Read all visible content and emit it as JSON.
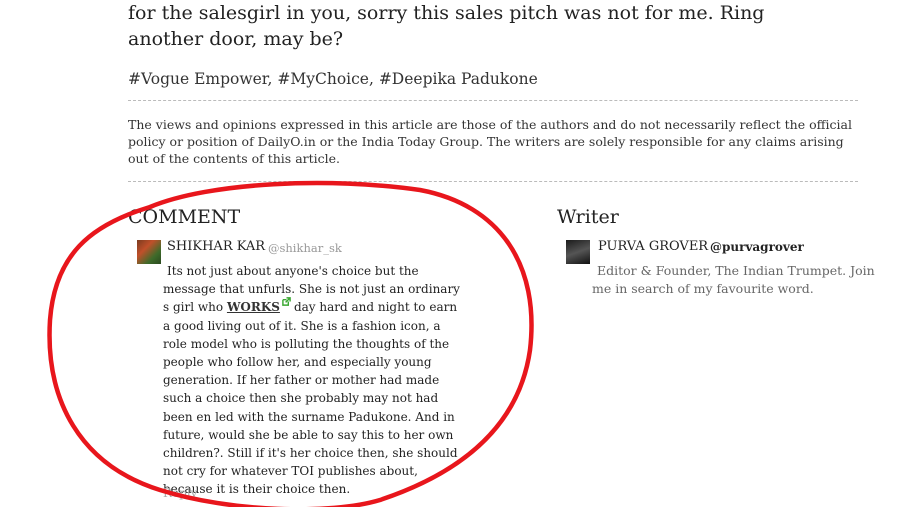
{
  "article": {
    "closing_text": "for the salesgirl in you, sorry this sales pitch was not for me. Ring another door, may be?",
    "tags": "#Vogue Empower, #MyChoice, #Deepika Padukone",
    "disclaimer": "The views and opinions expressed in this article are those of the authors and do not necessarily reflect the official policy or position of DailyO.in or the India Today Group. The writers are solely responsible for any claims arising out of the contents of this article."
  },
  "comments": {
    "heading": "COMMENT",
    "items": [
      {
        "author_name": "SHIKHAR KAR",
        "author_handle": "@shikhar_sk",
        "text_before_link": "Its not just about anyone's choice but the message that unfurls. She is not just an ordinary s girl who",
        "link_text": "WORKS",
        "text_after_link": "day hard and night to earn a good living out of it. She is a fashion icon, a role model who is polluting the thoughts of the people who follow her, and especially young generation. If her father or mother had made such a choice then she probably may not had been en led with the surname Padukone. And in future, would she be able to say this to her own children?. Still if it's her choice then, she should not cry for whatever TOI publishes about, because it is their choice then.",
        "reply_label": "Reply"
      }
    ]
  },
  "writer": {
    "heading": "Writer",
    "name": "PURVA GROVER",
    "handle": "@purvagrover",
    "bio": "Editor & Founder, The Indian Trumpet. Join me in search of my favourite word."
  },
  "icons": {
    "external_link": "external-link-icon"
  },
  "colors": {
    "annotation_circle": "#e8161c",
    "external_link_icon": "#3aa832",
    "handle_gray": "#999999"
  }
}
